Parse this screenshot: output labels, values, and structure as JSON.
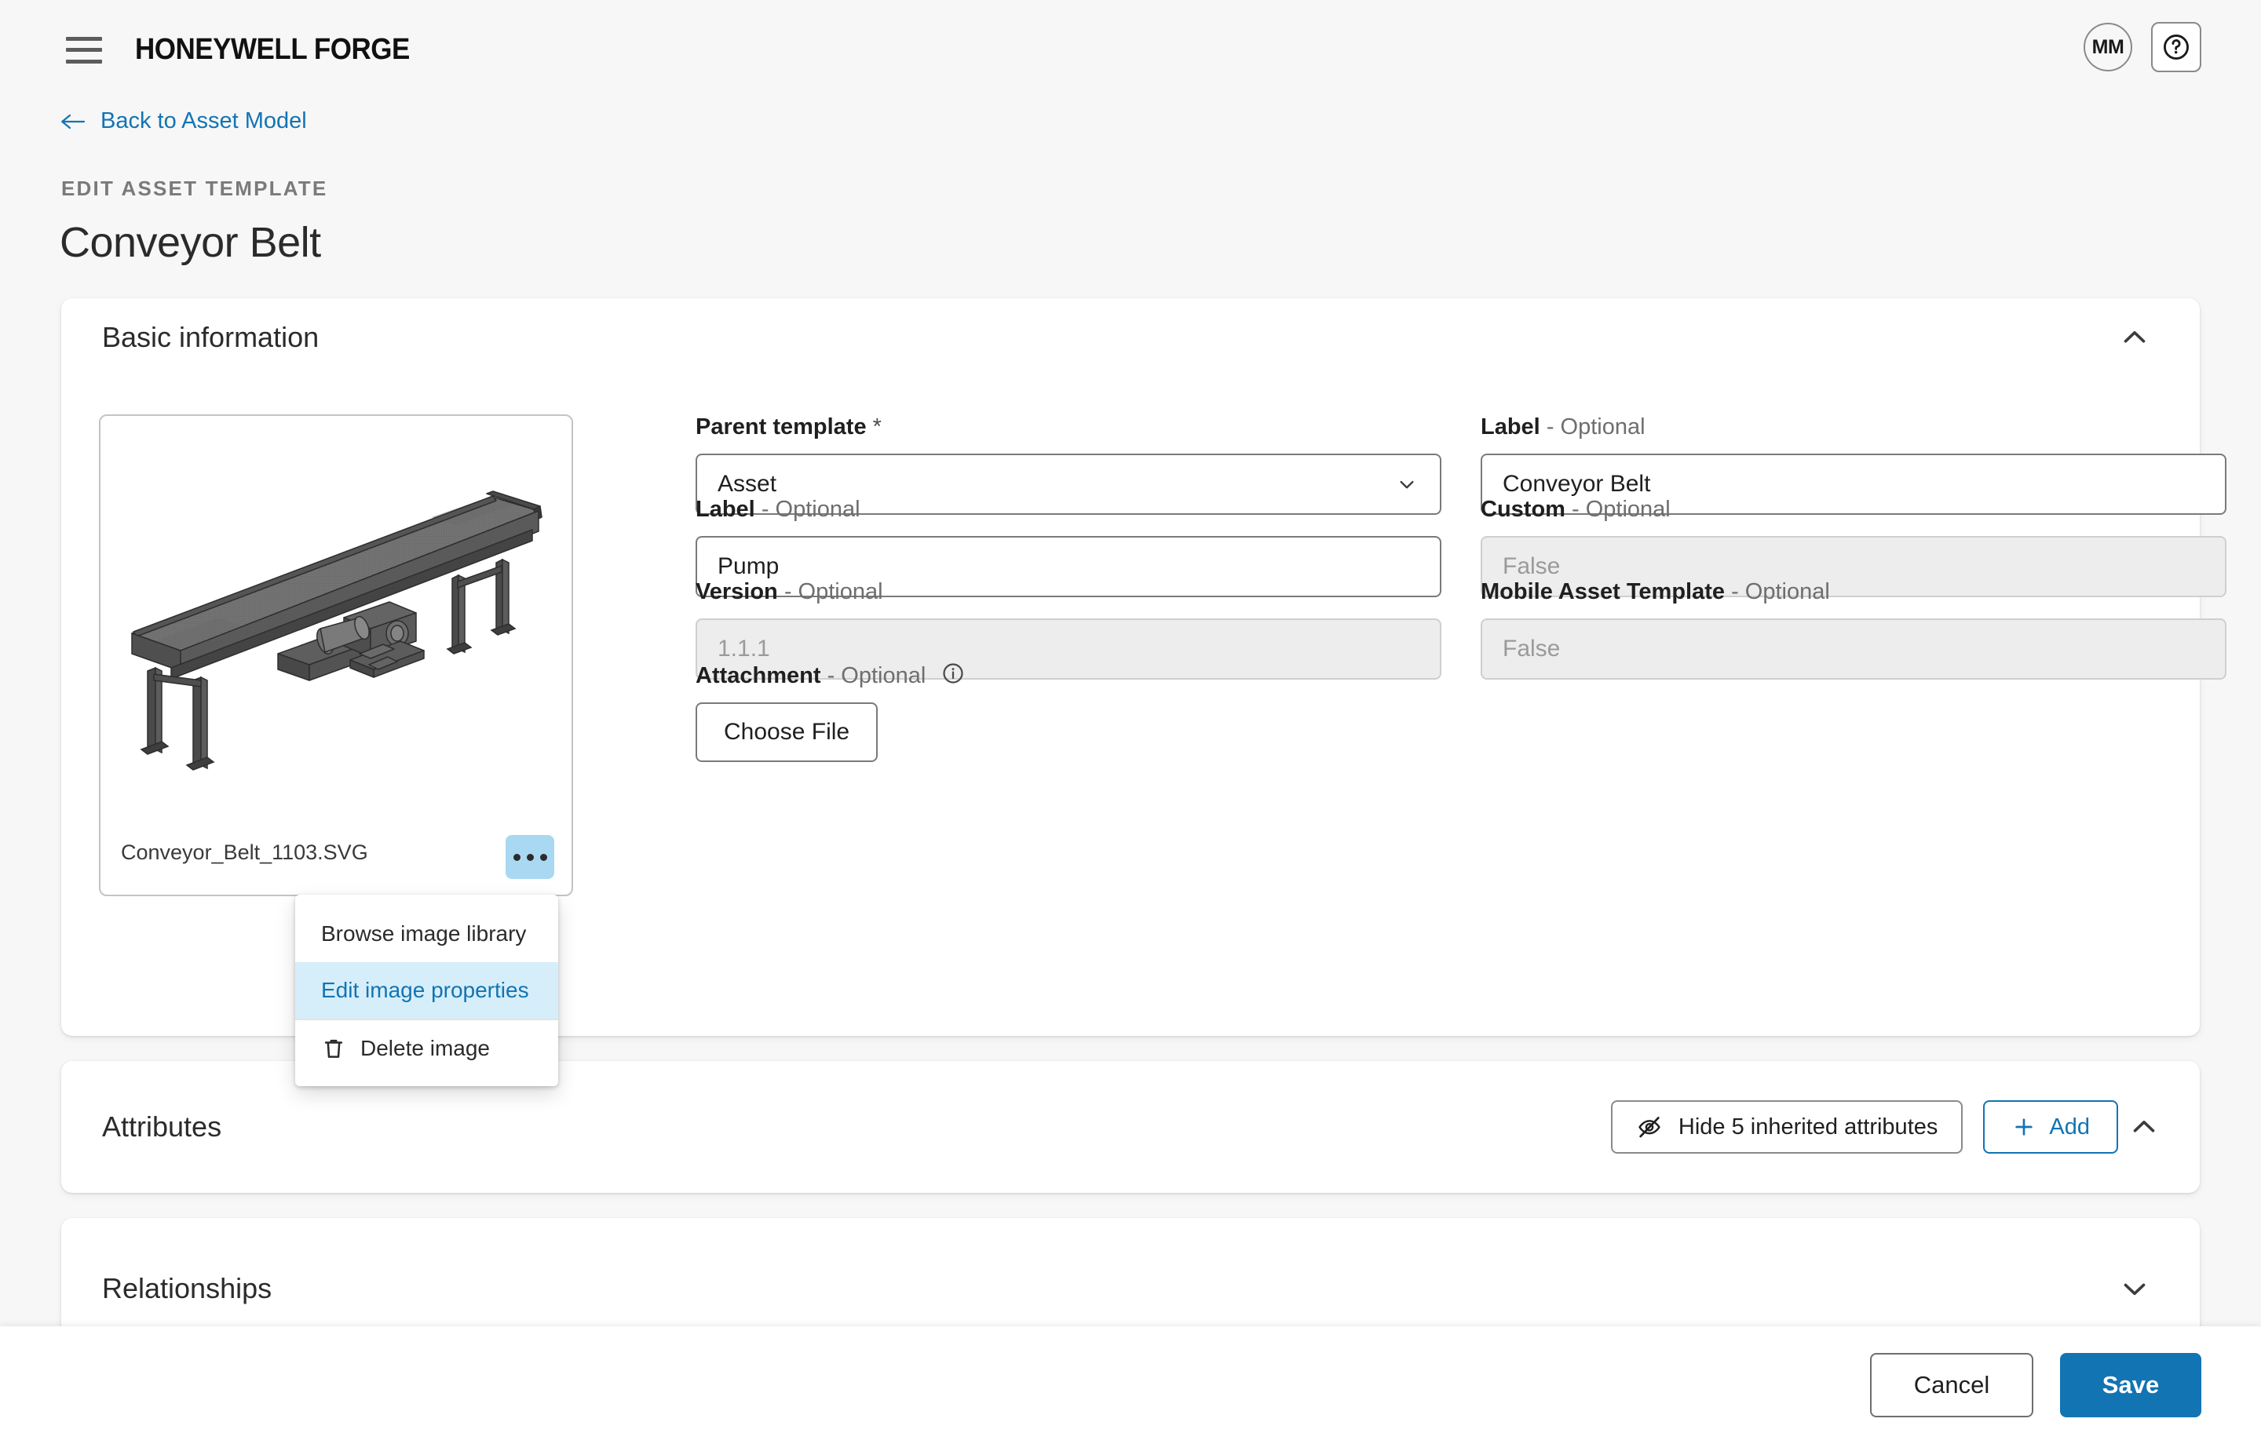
{
  "app": {
    "brand": "HONEYWELL FORGE",
    "avatar_initials": "MM"
  },
  "nav": {
    "back_label": "Back to Asset Model"
  },
  "page": {
    "eyebrow": "EDIT ASSET TEMPLATE",
    "title": "Conveyor Belt"
  },
  "colors": {
    "accent_blue": "#1274B3",
    "menu_highlight_bg": "#D6EEFA",
    "more_button_bg": "#A9D8F2",
    "page_bg": "#F7F7F7",
    "card_bg": "#FFFFFF",
    "disabled_field_bg": "#EDEDED"
  },
  "sections": {
    "basic": {
      "title": "Basic information",
      "chevron": "chevron-up"
    },
    "attributes": {
      "title": "Attributes",
      "chevron": "chevron-up"
    },
    "relationships": {
      "title": "Relationships",
      "chevron": "chevron-down"
    }
  },
  "image_tile": {
    "filename": "Conveyor_Belt_1103.SVG",
    "more_icon": "ellipsis-icon",
    "artwork": "conveyor-belt-isometric-drawing"
  },
  "image_menu": {
    "items": [
      {
        "label": "Browse image library",
        "icon": null,
        "active": false
      },
      {
        "label": "Edit image properties",
        "icon": null,
        "active": true
      },
      {
        "label": "Delete image",
        "icon": "trash-icon",
        "active": false
      }
    ]
  },
  "form": {
    "parent_template": {
      "label": "Parent template",
      "required_marker": "*",
      "value": "Asset",
      "chevron": "chevron-down-icon"
    },
    "label_left": {
      "label": "Label",
      "optional_suffix": "- Optional",
      "value": "Pump",
      "placeholder": ""
    },
    "version": {
      "label": "Version",
      "optional_suffix": "- Optional",
      "placeholder": "1.1.1",
      "disabled": true
    },
    "attachment": {
      "label": "Attachment",
      "optional_suffix": "- Optional",
      "info_icon": "info-icon",
      "button_label": "Choose File"
    },
    "label_right": {
      "label": "Label",
      "optional_suffix": "- Optional",
      "value": "Conveyor Belt",
      "placeholder": ""
    },
    "custom": {
      "label": "Custom",
      "optional_suffix": "- Optional",
      "placeholder": "False",
      "disabled": true
    },
    "mobile_asset_template": {
      "label": "Mobile Asset Template",
      "optional_suffix": "- Optional",
      "placeholder": "False",
      "disabled": true
    }
  },
  "attributes_actions": {
    "hide_inherited_label": "Hide 5 inherited attributes",
    "hide_inherited_icon": "eye-off-icon",
    "add_label": "Add",
    "add_icon": "plus-icon"
  },
  "footer": {
    "cancel_label": "Cancel",
    "save_label": "Save"
  }
}
